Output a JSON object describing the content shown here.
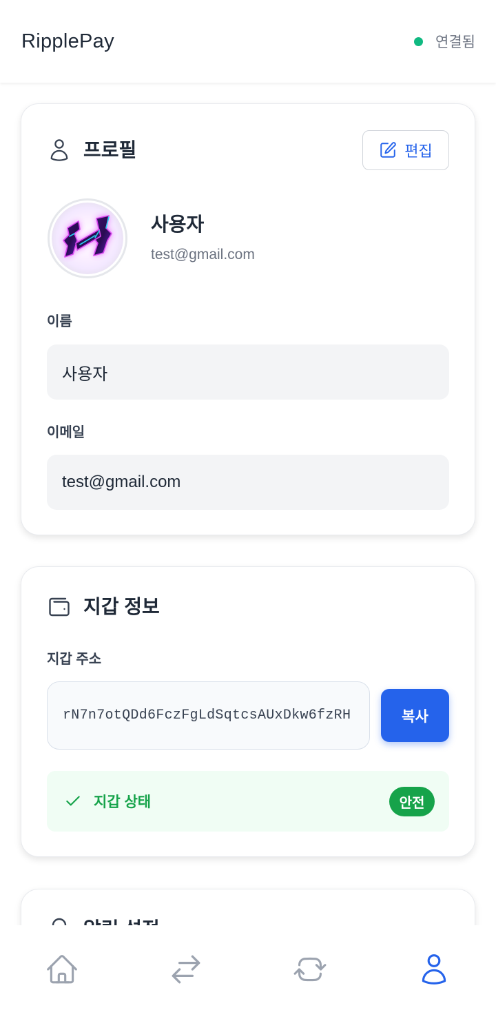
{
  "header": {
    "app_title": "RipplePay",
    "connection_status": "연결됨",
    "connection_icon": "status-dot-icon"
  },
  "profile": {
    "title": "프로필",
    "title_icon": "user-icon",
    "edit_button": {
      "label": "편집",
      "icon": "edit-icon"
    },
    "avatar_icon": "avatar-logo",
    "name": "사용자",
    "email": "test@gmail.com",
    "fields": [
      {
        "label": "이름",
        "value": "사용자"
      },
      {
        "label": "이메일",
        "value": "test@gmail.com"
      }
    ]
  },
  "wallet": {
    "title": "지갑 정보",
    "title_icon": "wallet-icon",
    "address_label": "지갑 주소",
    "address": "rN7n7otQDd6FczFgLdSqtcsAUxDkw6fzRH",
    "copy_button": "복사",
    "status": {
      "label": "지갑 상태",
      "icon": "check-icon",
      "badge": "안전"
    }
  },
  "notifications": {
    "title": "알림 설정",
    "title_icon": "bell-icon"
  },
  "bottom_nav": {
    "items": [
      {
        "icon": "home-icon",
        "active": false
      },
      {
        "icon": "arrows-right-left-icon",
        "active": false
      },
      {
        "icon": "arrow-path-icon",
        "active": false
      },
      {
        "icon": "user-icon",
        "active": true
      }
    ]
  },
  "colors": {
    "accent": "#2563eb",
    "connected": "#10b981",
    "success": "#16a34a",
    "success_bg": "#f0fdf4",
    "text": "#1f2937",
    "muted": "#6b7280",
    "inactive_icon": "#9ca3af"
  }
}
